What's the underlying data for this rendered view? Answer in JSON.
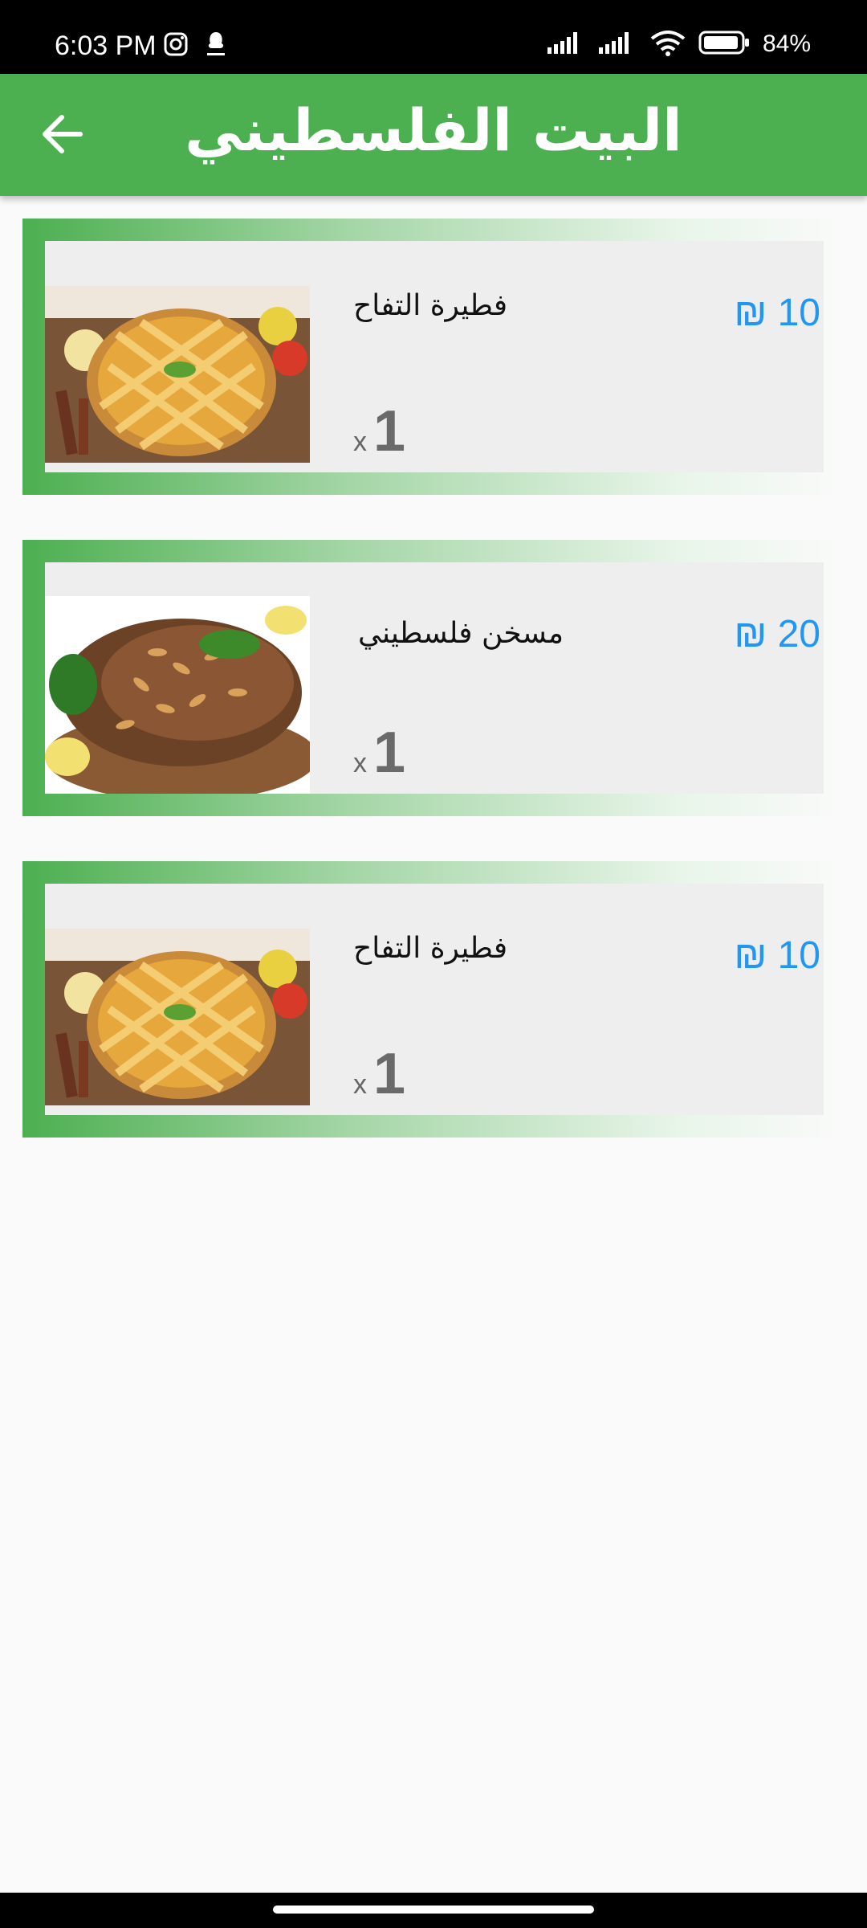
{
  "status_bar": {
    "time": "6:03 PM",
    "battery": "84%",
    "icons": [
      "instagram-icon",
      "app-notification-icon",
      "signal-icon",
      "signal-icon",
      "wifi-icon",
      "battery-icon"
    ]
  },
  "app_bar": {
    "title": "البيت الفلسطيني",
    "back_icon": "arrow-back-icon"
  },
  "cart_items": [
    {
      "name": "فطيرة التفاح",
      "price": "₪ 10",
      "quantity_prefix": "x",
      "quantity": "1",
      "image": "apple-pie-image"
    },
    {
      "name": "مسخن فلسطيني",
      "price": "₪ 20",
      "quantity_prefix": "x",
      "quantity": "1",
      "image": "musakhan-image"
    },
    {
      "name": "فطيرة التفاح",
      "price": "₪ 10",
      "quantity_prefix": "x",
      "quantity": "1",
      "image": "apple-pie-image"
    }
  ],
  "colors": {
    "primary": "#4CAF50",
    "price": "#2196F3",
    "card_bg": "#EEEEEE",
    "page_bg": "#FAFAFA"
  }
}
